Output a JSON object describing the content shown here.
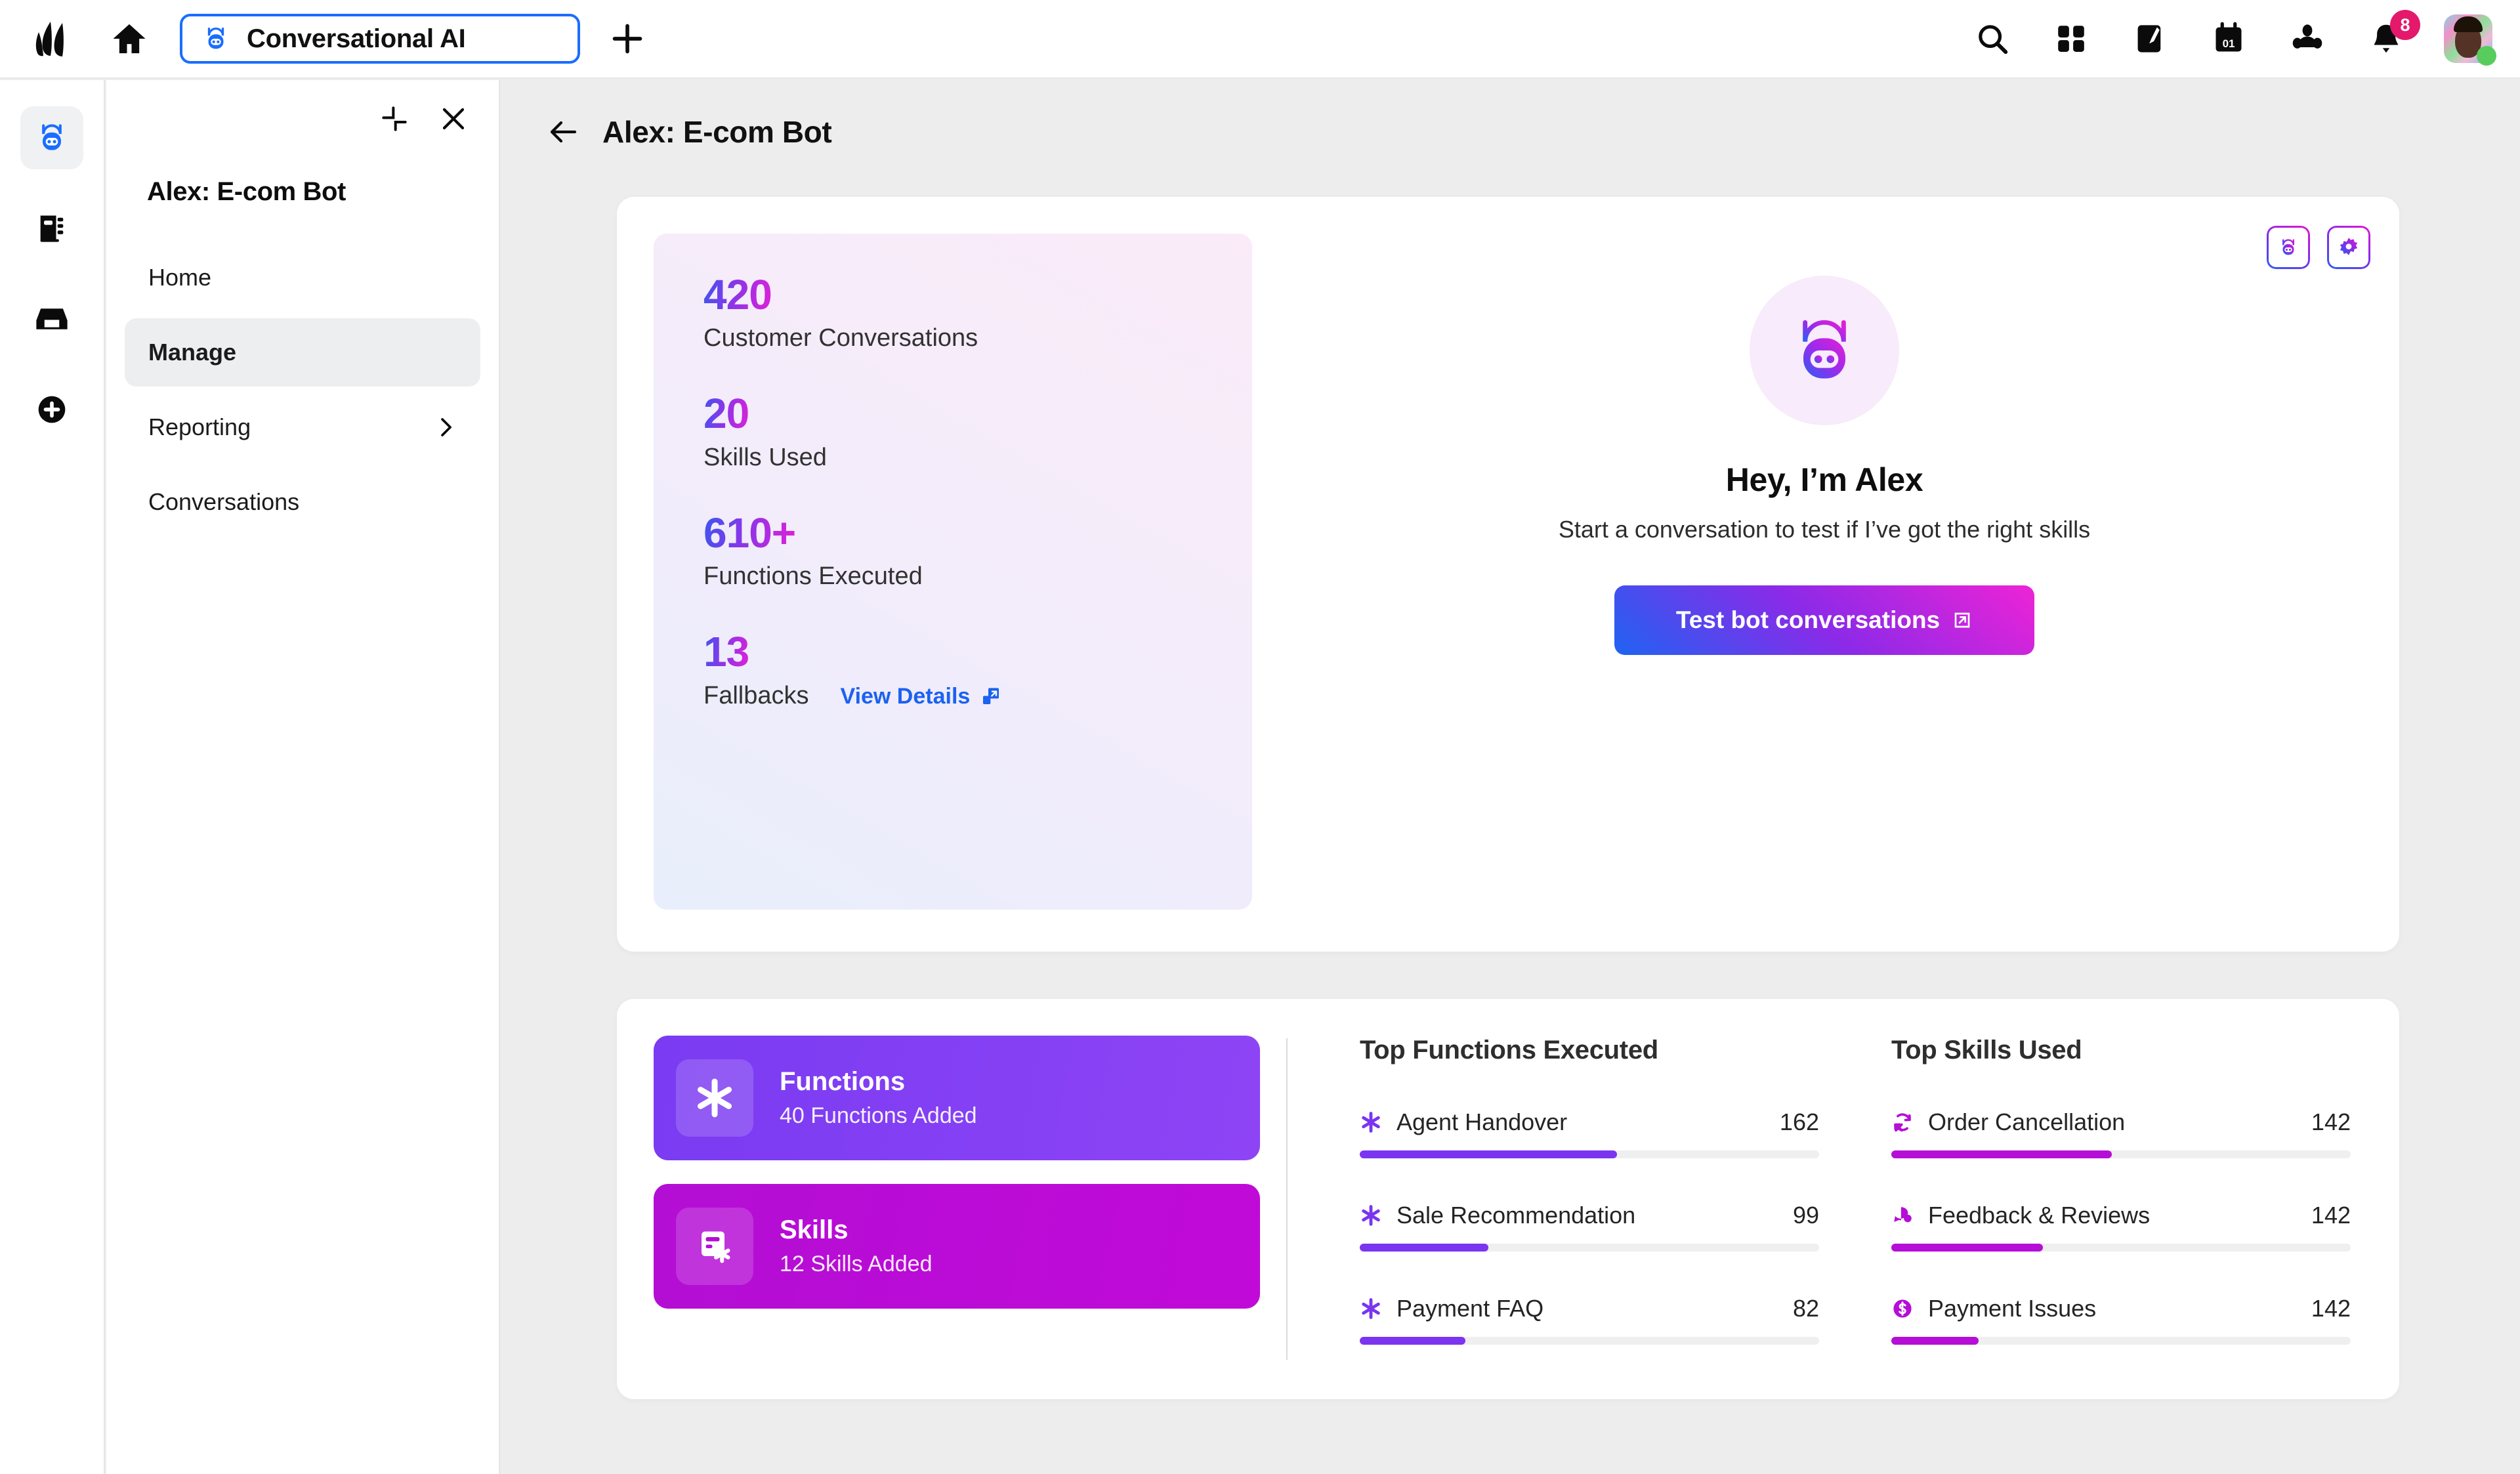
{
  "topbar": {
    "tab_label": "Conversational AI",
    "icons": [
      "search-icon",
      "apps-grid-icon",
      "compose-icon",
      "calendar-icon",
      "people-icon",
      "bell-icon"
    ],
    "notification_count": "8",
    "home_icon": "home-icon",
    "new_tab_icon": "plus-icon",
    "brand_icon": "leaf-logo-icon"
  },
  "rail": {
    "items": [
      {
        "icon": "bot-icon",
        "active": true
      },
      {
        "icon": "notebook-icon",
        "active": false
      },
      {
        "icon": "inbox-icon",
        "active": false
      },
      {
        "icon": "plus-circle-icon",
        "active": false
      }
    ]
  },
  "navpanel": {
    "collapse_icon": "collapse-icon",
    "close_icon": "close-icon",
    "title": "Alex: E-com Bot",
    "items": [
      {
        "label": "Home",
        "active": false,
        "chevron": false
      },
      {
        "label": "Manage",
        "active": true,
        "chevron": false
      },
      {
        "label": "Reporting",
        "active": false,
        "chevron": true
      },
      {
        "label": "Conversations",
        "active": false,
        "chevron": false
      }
    ]
  },
  "page": {
    "back_icon": "back-arrow-icon",
    "title": "Alex: E-com Bot"
  },
  "stats": [
    {
      "value": "420",
      "label": "Customer Conversations"
    },
    {
      "value": "20",
      "label": "Skills Used"
    },
    {
      "value": "610+",
      "label": "Functions Executed"
    },
    {
      "value": "13",
      "label": "Fallbacks"
    }
  ],
  "view_details": {
    "label": "View Details",
    "icon": "external-window-icon"
  },
  "card_actions": [
    {
      "icon": "bot-icon",
      "name": "bot-preview-button"
    },
    {
      "icon": "gear-icon",
      "name": "settings-button"
    }
  ],
  "hero": {
    "avatar_icon": "bot-avatar-icon",
    "heading": "Hey, I’m Alex",
    "subheading": "Start a conversation to test if I’ve got the right skills",
    "cta_label": "Test bot conversations",
    "cta_icon": "external-link-icon"
  },
  "tiles": [
    {
      "title": "Functions",
      "subtitle": "40 Functions Added",
      "icon": "asterisk-icon",
      "color": "#7a3bf2"
    },
    {
      "title": "Skills",
      "subtitle": "12 Skills Added",
      "icon": "skill-card-icon",
      "color": "#b30ed4"
    }
  ],
  "chart_data": [
    {
      "type": "bar",
      "title": "Top Functions Executed",
      "orientation": "horizontal",
      "categories": [
        "Agent Handover",
        "Sale Recommendation",
        "Payment FAQ"
      ],
      "values": [
        162,
        99,
        82
      ],
      "icons": [
        "asterisk-icon",
        "asterisk-icon",
        "asterisk-icon"
      ],
      "bar_percent": [
        56,
        28,
        23
      ],
      "bar_color": "#7b34f0",
      "track_color": "#efefef",
      "xlabel": "",
      "ylabel": "",
      "grid": false,
      "legend": "none"
    },
    {
      "type": "bar",
      "title": "Top Skills Used",
      "orientation": "horizontal",
      "categories": [
        "Order Cancellation",
        "Feedback & Reviews",
        "Payment Issues"
      ],
      "values": [
        142,
        142,
        142
      ],
      "icons": [
        "order-cancel-icon",
        "chat-bubble-icon",
        "dollar-circle-icon"
      ],
      "bar_percent": [
        48,
        33,
        19
      ],
      "bar_color": "#b50ed6",
      "track_color": "#efefef",
      "xlabel": "",
      "ylabel": "",
      "grid": false,
      "legend": "none"
    }
  ],
  "colors": {
    "accent_blue": "#1b62f0",
    "gradient_start": "#1f63f2",
    "gradient_mid": "#8b2ae8",
    "gradient_end": "#ee23d6",
    "badge": "#e4196b",
    "online": "#58cc5c",
    "page_bg": "#ededed"
  }
}
